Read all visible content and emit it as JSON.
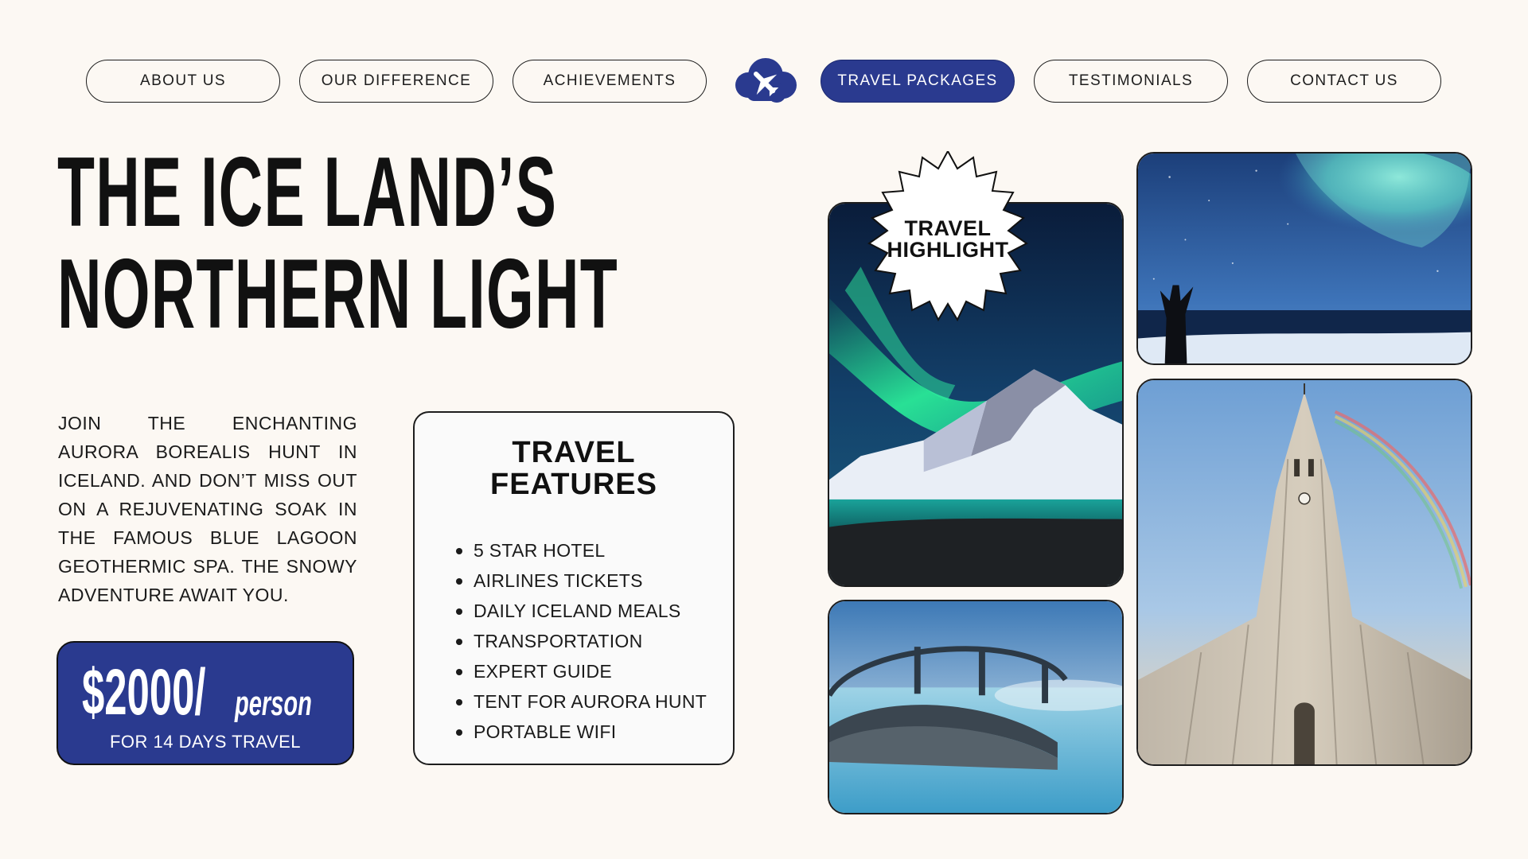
{
  "nav": {
    "items": [
      {
        "label": "ABOUT US"
      },
      {
        "label": "OUR DIFFERENCE"
      },
      {
        "label": "ACHIEVEMENTS"
      },
      {
        "label": "TRAVEL PACKAGES",
        "active": true
      },
      {
        "label": "TESTIMONIALS"
      },
      {
        "label": "CONTACT US"
      }
    ],
    "logo_icon": "cloud-airplane-icon"
  },
  "hero": {
    "title_line1": "THE ICE LAND’S",
    "title_line2": "NORTHERN LIGHT",
    "description": "JOIN THE ENCHANTING AURORA BOREALIS HUNT IN ICELAND. AND DON’T MISS OUT ON A REJUVENATING SOAK IN THE FAMOUS BLUE LAGOON GEOTHERMIC SPA. THE SNOWY ADVENTURE AWAIT YOU."
  },
  "price": {
    "amount": "$2000/",
    "unit": "person",
    "subtitle": "FOR 14 DAYS TRAVEL"
  },
  "features": {
    "title_line1": "TRAVEL",
    "title_line2": "FEATURES",
    "items": [
      "5 STAR HOTEL",
      "AIRLINES TICKETS",
      "DAILY ICELAND MEALS",
      "TRANSPORTATION",
      "EXPERT GUIDE",
      "TENT FOR AURORA HUNT",
      "PORTABLE WIFI"
    ]
  },
  "badge": {
    "line1": "TRAVEL",
    "line2": "HIGHLIGHT"
  },
  "colors": {
    "background": "#fcf8f3",
    "accent": "#2a3a8f",
    "text": "#111111"
  }
}
